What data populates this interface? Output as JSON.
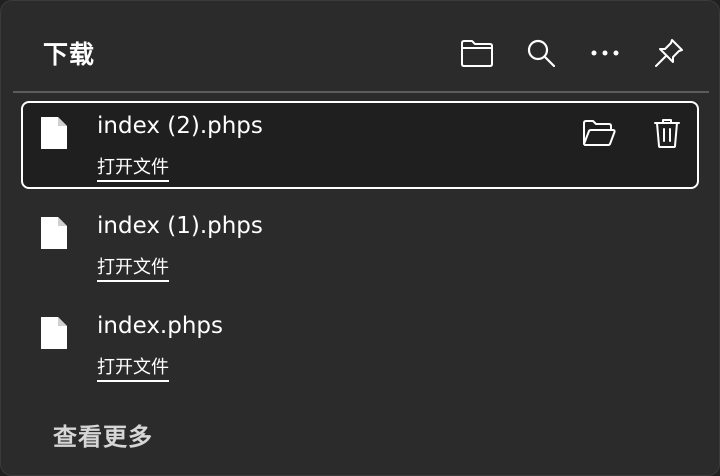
{
  "header": {
    "title": "下载",
    "actions": [
      {
        "icon": "folder-icon"
      },
      {
        "icon": "search-icon"
      },
      {
        "icon": "more-icon"
      },
      {
        "icon": "pin-icon"
      }
    ]
  },
  "downloads": [
    {
      "name": "index (2).phps",
      "action_label": "打开文件",
      "selected": true
    },
    {
      "name": "index (1).phps",
      "action_label": "打开文件",
      "selected": false
    },
    {
      "name": "index.phps",
      "action_label": "打开文件",
      "selected": false
    }
  ],
  "footer": {
    "see_more": "查看更多"
  },
  "colors": {
    "background": "#2b2b2b",
    "selected_row": "#1f1f1f",
    "text": "#ffffff"
  }
}
